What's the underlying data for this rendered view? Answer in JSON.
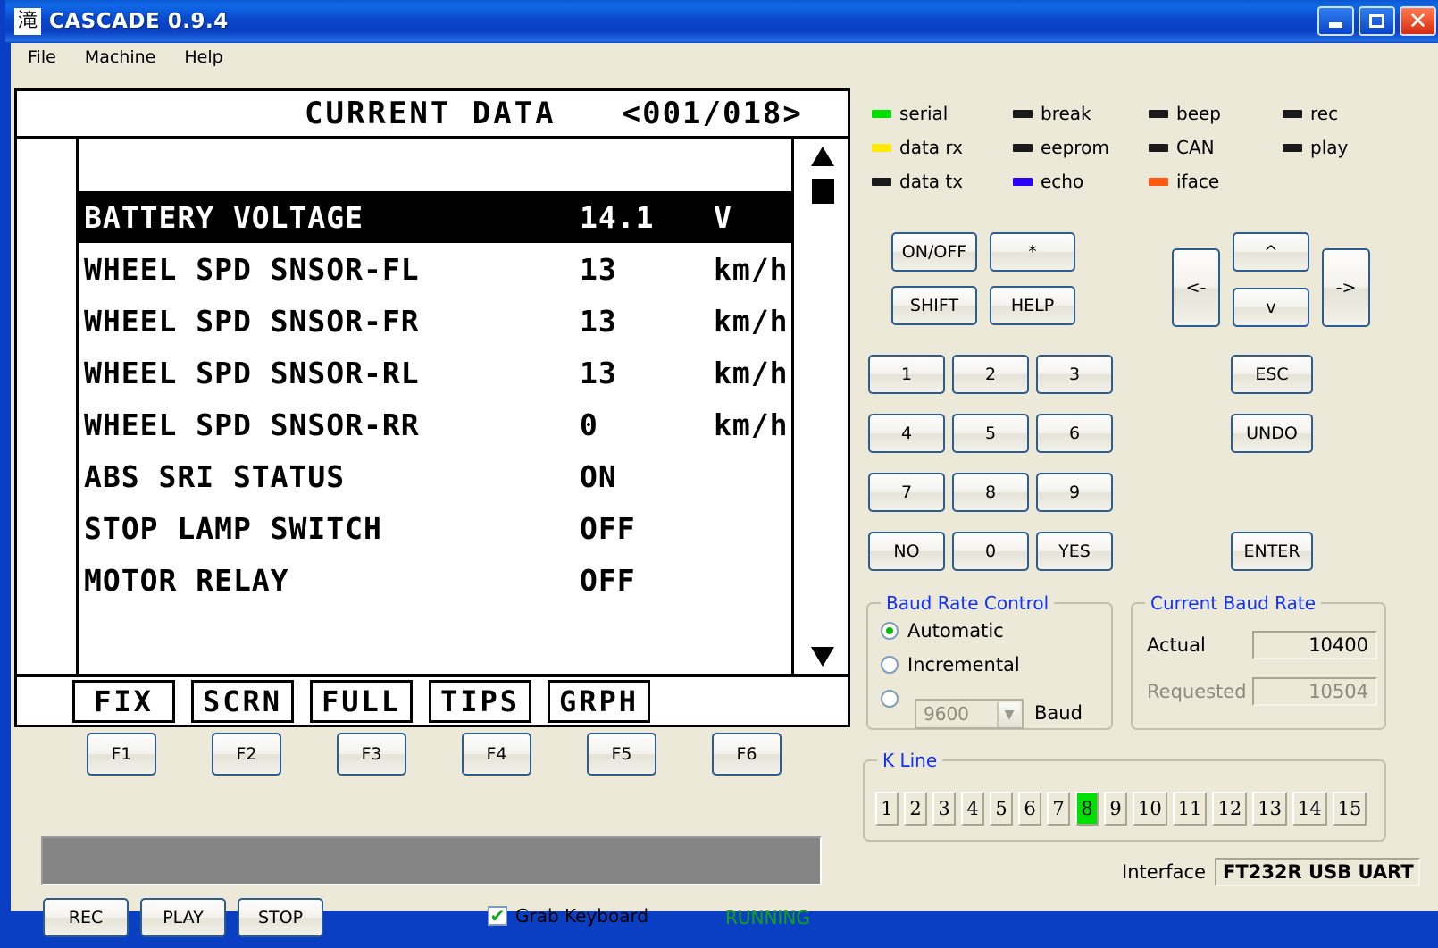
{
  "window": {
    "icon_glyph": "滝",
    "title": "CASCADE 0.9.4",
    "minimize": "_",
    "maximize": "□",
    "close": "✕"
  },
  "menu": {
    "items": [
      "File",
      "Machine",
      "Help"
    ]
  },
  "lcd": {
    "header_title": "CURRENT  DATA",
    "header_page": "<001/018>",
    "rows": [
      {
        "name": "BATTERY VOLTAGE",
        "value": "14.1",
        "unit": "V",
        "selected": true
      },
      {
        "name": "WHEEL SPD SNSOR-FL",
        "value": "13",
        "unit": "km/h",
        "selected": false
      },
      {
        "name": "WHEEL SPD SNSOR-FR",
        "value": "13",
        "unit": "km/h",
        "selected": false
      },
      {
        "name": "WHEEL SPD SNSOR-RL",
        "value": "13",
        "unit": "km/h",
        "selected": false
      },
      {
        "name": "WHEEL SPD SNSOR-RR",
        "value": "0",
        "unit": "km/h",
        "selected": false
      },
      {
        "name": "ABS SRI STATUS",
        "value": "ON",
        "unit": "",
        "selected": false
      },
      {
        "name": "STOP LAMP SWITCH",
        "value": "OFF",
        "unit": "",
        "selected": false
      },
      {
        "name": "MOTOR RELAY",
        "value": "OFF",
        "unit": "",
        "selected": false
      }
    ],
    "soft_labels": [
      "FIX",
      "SCRN",
      "FULL",
      "TIPS",
      "GRPH"
    ],
    "scroll_up_icon": "scroll-up-arrow",
    "scroll_down_icon": "scroll-down-arrow"
  },
  "fkeys": [
    "F1",
    "F2",
    "F3",
    "F4",
    "F5",
    "F6"
  ],
  "transport": {
    "rec": "REC",
    "play": "PLAY",
    "stop": "STOP",
    "grab_keyboard_label": "Grab Keyboard",
    "grab_keyboard_checked": true,
    "check_glyph": "✔",
    "status": "RUNNING",
    "status_color": "#11a611"
  },
  "leds": [
    [
      {
        "label": "serial",
        "color": "#00e000"
      },
      {
        "label": "data rx",
        "color": "#ffea00"
      },
      {
        "label": "data tx",
        "color": "#1a1a1a"
      }
    ],
    [
      {
        "label": "break",
        "color": "#1a1a1a"
      },
      {
        "label": "eeprom",
        "color": "#1a1a1a"
      },
      {
        "label": "echo",
        "color": "#2a00ff"
      }
    ],
    [
      {
        "label": "beep",
        "color": "#1a1a1a"
      },
      {
        "label": "CAN",
        "color": "#1a1a1a"
      },
      {
        "label": "iface",
        "color": "#ff5a11"
      }
    ],
    [
      {
        "label": "rec",
        "color": "#1a1a1a"
      },
      {
        "label": "play",
        "color": "#1a1a1a"
      }
    ]
  ],
  "keypad": {
    "onoff": "ON/OFF",
    "star": "*",
    "shift": "SHIFT",
    "help": "HELP",
    "digits": [
      "1",
      "2",
      "3",
      "4",
      "5",
      "6",
      "7",
      "8",
      "9"
    ],
    "no": "NO",
    "zero": "0",
    "yes": "YES",
    "left": "<-",
    "up": "^",
    "down": "v",
    "right": "->",
    "esc": "ESC",
    "undo": "UNDO",
    "enter": "ENTER"
  },
  "baud_control": {
    "legend": "Baud Rate Control",
    "automatic": "Automatic",
    "incremental": "Incremental",
    "selected": "Automatic",
    "manual_value": "9600",
    "manual_unit": "Baud",
    "dropdown_glyph": "▼"
  },
  "current_baud": {
    "legend": "Current Baud Rate",
    "actual_label": "Actual",
    "actual_value": "10400",
    "requested_label": "Requested",
    "requested_value": "10504"
  },
  "kline": {
    "legend": "K Line",
    "boxes": [
      "1",
      "2",
      "3",
      "4",
      "5",
      "6",
      "7",
      "8",
      "9",
      "10",
      "11",
      "12",
      "13",
      "14",
      "15"
    ],
    "active": "8",
    "active_color": "#00e000"
  },
  "interface": {
    "label": "Interface",
    "value": "FT232R USB UART"
  }
}
